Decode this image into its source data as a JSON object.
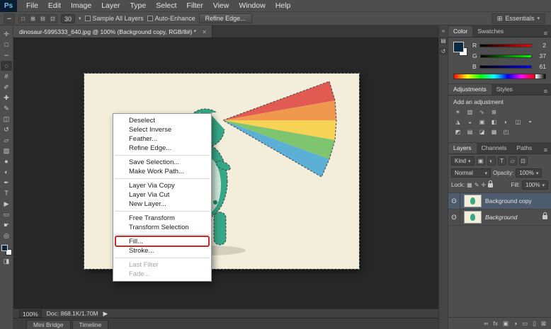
{
  "colors": {
    "selection_blue": "#4c5b6e",
    "redbox": "#c92a21",
    "dino": "#35a888",
    "canvas_paper": "#f2eedb",
    "fg_swatch": "#0b2940"
  },
  "ui": {
    "arrow": "▾",
    "menu_glyph": "≡"
  },
  "menubar": {
    "logo": "Ps",
    "items": [
      "File",
      "Edit",
      "Image",
      "Layer",
      "Type",
      "Select",
      "Filter",
      "View",
      "Window",
      "Help"
    ]
  },
  "optionsbar": {
    "tool_glyph": "∽",
    "mode_icons": [
      "□",
      "⊞",
      "⊟",
      "⊡"
    ],
    "brush_value": "30",
    "sample_all_layers": "Sample All Layers",
    "auto_enhance": "Auto-Enhance",
    "refine_edge": "Refine Edge...",
    "workspace_icon": "⊞",
    "workspace": "Essentials"
  },
  "tabbar": {
    "doc_title": "dinosaur-5995333_640.jpg @ 100% (Background copy, RGB/8#) *",
    "close": "×"
  },
  "toolbar": {
    "tools": [
      {
        "name": "move",
        "glyph": "✛"
      },
      {
        "name": "rectangular-marquee",
        "glyph": "□"
      },
      {
        "name": "lasso",
        "glyph": "∽"
      },
      {
        "name": "quick-selection",
        "glyph": "◌"
      },
      {
        "name": "crop",
        "glyph": "#"
      },
      {
        "name": "eyedropper",
        "glyph": "✐"
      },
      {
        "name": "healing-brush",
        "glyph": "✚"
      },
      {
        "name": "brush",
        "glyph": "✎"
      },
      {
        "name": "clone-stamp",
        "glyph": "◫"
      },
      {
        "name": "history-brush",
        "glyph": "↺"
      },
      {
        "name": "eraser",
        "glyph": "▱"
      },
      {
        "name": "gradient",
        "glyph": "▨"
      },
      {
        "name": "blur",
        "glyph": "●"
      },
      {
        "name": "dodge",
        "glyph": "◐"
      },
      {
        "name": "pen",
        "glyph": "✒"
      },
      {
        "name": "type",
        "glyph": "T"
      },
      {
        "name": "path-selection",
        "glyph": "▶"
      },
      {
        "name": "rectangle",
        "glyph": "▭"
      },
      {
        "name": "hand",
        "glyph": "☛"
      },
      {
        "name": "zoom",
        "glyph": "◎"
      }
    ],
    "quick_mask": "◨"
  },
  "image": {
    "rainbow_colors": [
      "#e15b52",
      "#f0984d",
      "#f6d355",
      "#7fc46e",
      "#5cb0d5"
    ],
    "belly_color": "#cde8d8",
    "spot_color": "#1f8169"
  },
  "context_menu": {
    "items": [
      "Deselect",
      "Select Inverse",
      "Feather...",
      "Refine Edge...",
      "Save Selection...",
      "Make Work Path...",
      "Layer Via Copy",
      "Layer Via Cut",
      "New Layer...",
      "Free Transform",
      "Transform Selection",
      "Fill...",
      "Stroke...",
      "Last Filter",
      "Fade..."
    ]
  },
  "color_panel": {
    "tabs": [
      "Color",
      "Swatches"
    ],
    "channels": [
      {
        "label": "R",
        "value": "2"
      },
      {
        "label": "G",
        "value": "37"
      },
      {
        "label": "B",
        "value": "61"
      }
    ]
  },
  "adjustments_panel": {
    "tabs": [
      "Adjustments",
      "Styles"
    ],
    "heading": "Add an adjustment",
    "rows": [
      [
        "☀",
        "▥",
        "∿",
        "⊞"
      ],
      [
        "◮",
        "◒",
        "▣",
        "◧",
        "◐",
        "◫",
        "◓"
      ],
      [
        "◩",
        "▤",
        "◪",
        "▦",
        "◰"
      ]
    ]
  },
  "layers_panel": {
    "tabs": [
      "Layers",
      "Channels",
      "Paths"
    ],
    "kind_label": "Kind",
    "filter_icons": [
      "▣",
      "◐",
      "T",
      "▱",
      "⊡"
    ],
    "blend_mode": "Normal",
    "opacity_label": "Opacity:",
    "opacity_value": "100%",
    "lock_label": "Lock:",
    "lock_icons": [
      "▦",
      "✎",
      "✛"
    ],
    "fill_label": "Fill:",
    "fill_value": "100%",
    "eye": "ʘ",
    "layers": [
      {
        "name": "Background copy"
      },
      {
        "name": "Background"
      }
    ],
    "bottom_icons": [
      "∞",
      "fx",
      "▣",
      "◑",
      "▭",
      "▯",
      "⊠"
    ]
  },
  "statusbar": {
    "zoom": "100%",
    "doc_info": "Doc: 868.1K/1.70M",
    "arrow": "▶"
  },
  "bottom_tabs": [
    "Mini Bridge",
    "Timeline"
  ],
  "side_strip": {
    "collapse": "«",
    "icons": [
      "▤",
      "↺"
    ]
  }
}
